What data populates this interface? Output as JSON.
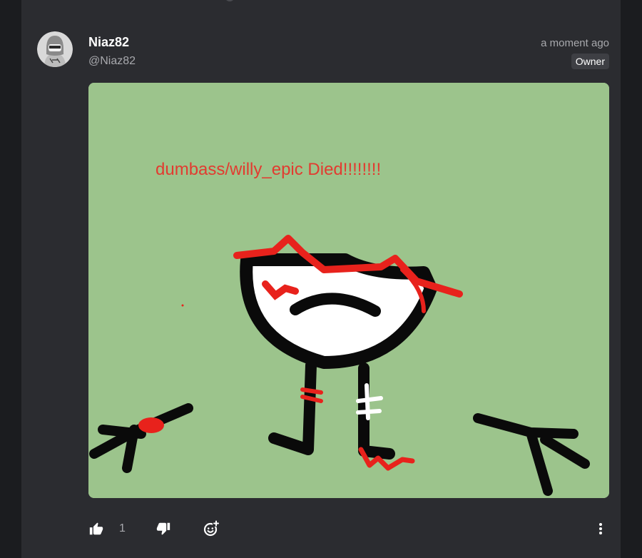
{
  "post": {
    "author": {
      "display_name": "Niaz82",
      "handle": "@Niaz82",
      "avatar_icon": "hooded-character-avatar"
    },
    "timestamp": "a moment ago",
    "role_badge": "Owner",
    "image": {
      "caption_text": "dumbass/willy_epic Died!!!!!!!!",
      "background_color": "#9cc48c",
      "accent_color": "#e23b30"
    },
    "actions": {
      "like_icon": "thumbs-up-icon",
      "like_count": "1",
      "dislike_icon": "thumbs-down-icon",
      "react_icon": "add-reaction-icon",
      "more_icon": "more-vertical-icon"
    }
  },
  "theme": {
    "background": "#2b2c30",
    "text_primary": "#ffffff",
    "text_secondary": "#a8a9ad"
  }
}
